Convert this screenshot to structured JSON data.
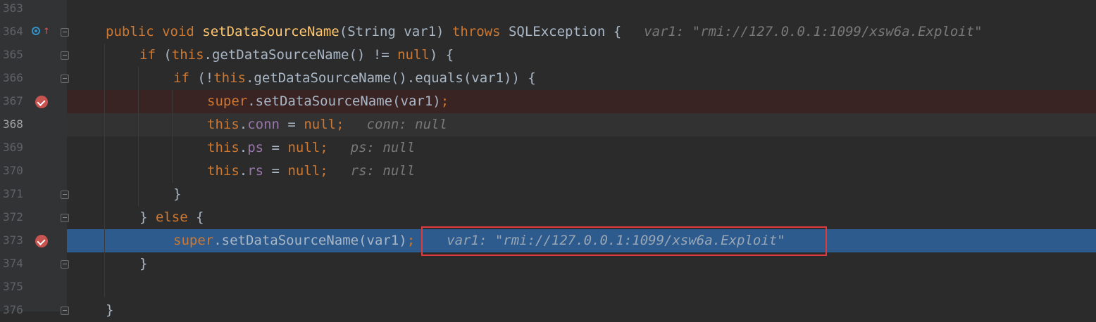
{
  "lines": [
    {
      "no": "363"
    },
    {
      "no": "364",
      "tokens": [
        {
          "t": "public void ",
          "c": "kw"
        },
        {
          "t": "setDataSourceName",
          "c": "fn"
        },
        {
          "t": "(String var1) ",
          "c": "plain"
        },
        {
          "t": "throws ",
          "c": "kw"
        },
        {
          "t": "SQLException {",
          "c": "plain"
        }
      ],
      "hint": "var1: \"rmi://127.0.0.1:1099/xsw6a.Exploit\""
    },
    {
      "no": "365",
      "tokens": [
        {
          "t": "if ",
          "c": "kw"
        },
        {
          "t": "(",
          "c": "plain"
        },
        {
          "t": "this",
          "c": "kw"
        },
        {
          "t": ".getDataSourceName() != ",
          "c": "plain"
        },
        {
          "t": "null",
          "c": "kw"
        },
        {
          "t": ") {",
          "c": "plain"
        }
      ]
    },
    {
      "no": "366",
      "tokens": [
        {
          "t": "if ",
          "c": "kw"
        },
        {
          "t": "(!",
          "c": "plain"
        },
        {
          "t": "this",
          "c": "kw"
        },
        {
          "t": ".getDataSourceName().equals(var1)) {",
          "c": "plain"
        }
      ]
    },
    {
      "no": "367",
      "tokens": [
        {
          "t": "super",
          "c": "kw"
        },
        {
          "t": ".setDataSourceName(var1)",
          "c": "plain"
        },
        {
          "t": ";",
          "c": "kw"
        }
      ]
    },
    {
      "no": "368",
      "tokens": [
        {
          "t": "this",
          "c": "kw"
        },
        {
          "t": ".",
          "c": "plain"
        },
        {
          "t": "conn",
          "c": "field"
        },
        {
          "t": " = ",
          "c": "plain"
        },
        {
          "t": "null;",
          "c": "kw"
        }
      ],
      "hint": "conn: null"
    },
    {
      "no": "369",
      "tokens": [
        {
          "t": "this",
          "c": "kw"
        },
        {
          "t": ".",
          "c": "plain"
        },
        {
          "t": "ps",
          "c": "field"
        },
        {
          "t": " = ",
          "c": "plain"
        },
        {
          "t": "null;",
          "c": "kw"
        }
      ],
      "hint": "ps: null"
    },
    {
      "no": "370",
      "tokens": [
        {
          "t": "this",
          "c": "kw"
        },
        {
          "t": ".",
          "c": "plain"
        },
        {
          "t": "rs",
          "c": "field"
        },
        {
          "t": " = ",
          "c": "plain"
        },
        {
          "t": "null;",
          "c": "kw"
        }
      ],
      "hint": "rs: null"
    },
    {
      "no": "371",
      "tokens": [
        {
          "t": "}",
          "c": "plain"
        }
      ]
    },
    {
      "no": "372",
      "tokens": [
        {
          "t": "} ",
          "c": "plain"
        },
        {
          "t": "else ",
          "c": "kw"
        },
        {
          "t": "{",
          "c": "plain"
        }
      ]
    },
    {
      "no": "373",
      "tokens": [
        {
          "t": "super",
          "c": "kw"
        },
        {
          "t": ".setDataSourceName(var1)",
          "c": "plain"
        },
        {
          "t": ";",
          "c": "kw"
        }
      ],
      "hint": "var1: \"rmi://127.0.0.1:1099/xsw6a.Exploit\""
    },
    {
      "no": "374",
      "tokens": [
        {
          "t": "}",
          "c": "plain"
        }
      ]
    },
    {
      "no": "375"
    },
    {
      "no": "376",
      "tokens": [
        {
          "t": "}",
          "c": "plain"
        }
      ]
    }
  ],
  "colors": {
    "background": "#2b2b2b",
    "gutter": "#313335",
    "keyword": "#cc7832",
    "function": "#ffc66d",
    "field": "#9876aa",
    "execution_line": "#2d5b8d",
    "breakpoint": "#c75450",
    "highlight_box": "#e0393e"
  },
  "icons": {
    "line_364": [
      "override-icon",
      "up-arrow-icon"
    ],
    "line_367": "breakpoint-icon",
    "line_373": "breakpoint-icon"
  }
}
